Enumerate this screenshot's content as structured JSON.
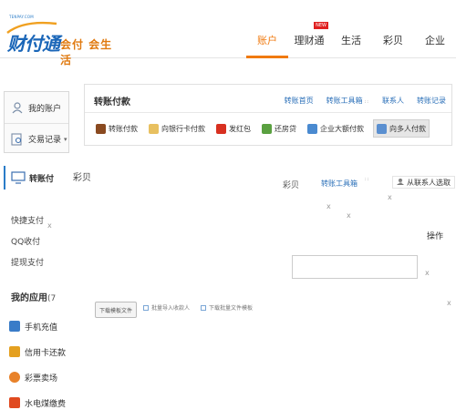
{
  "header": {
    "logo_small": "TENPAY.COM",
    "logo_text": "财付通",
    "logo_slogan": "会付 会生活",
    "nav": [
      {
        "label": "账户",
        "active": true
      },
      {
        "label": "理财通",
        "badge": "NEW"
      },
      {
        "label": "生活"
      },
      {
        "label": "彩贝"
      },
      {
        "label": "企业"
      }
    ]
  },
  "sidebar": {
    "my_account": "我的账户",
    "transactions": "交易记录",
    "transfer": "转账付",
    "pay_links": [
      "快捷支付",
      "QQ收付",
      "提现支付"
    ],
    "my_apps_title": "我的应用",
    "my_apps_count": "(7",
    "apps": [
      "手机充值",
      "信用卡还款",
      "彩票卖场",
      "水电煤缴费"
    ]
  },
  "main": {
    "title": "转账付款",
    "top_links": [
      "转账首页",
      "转账工具箱",
      "联系人",
      "转账记录"
    ],
    "tools": [
      "转账付款",
      "向银行卡付款",
      "发红包",
      "还房贷",
      "企业大额付款",
      "向多人付款"
    ]
  },
  "ghosted": {
    "tab_caibei": "彩贝",
    "caibei_right": "彩贝",
    "toolbox_link": "转账工具箱",
    "from_contacts": "从联系人选取",
    "operation": "操作",
    "batch_button": "下载模板文件",
    "batch_link_1": "批量导入收款人",
    "batch_link_2": "下载批量文件模板",
    "x": "x"
  },
  "colors": {
    "accent": "#f07a10",
    "link": "#2a6fb8",
    "brand_blue": "#1a66b8"
  }
}
